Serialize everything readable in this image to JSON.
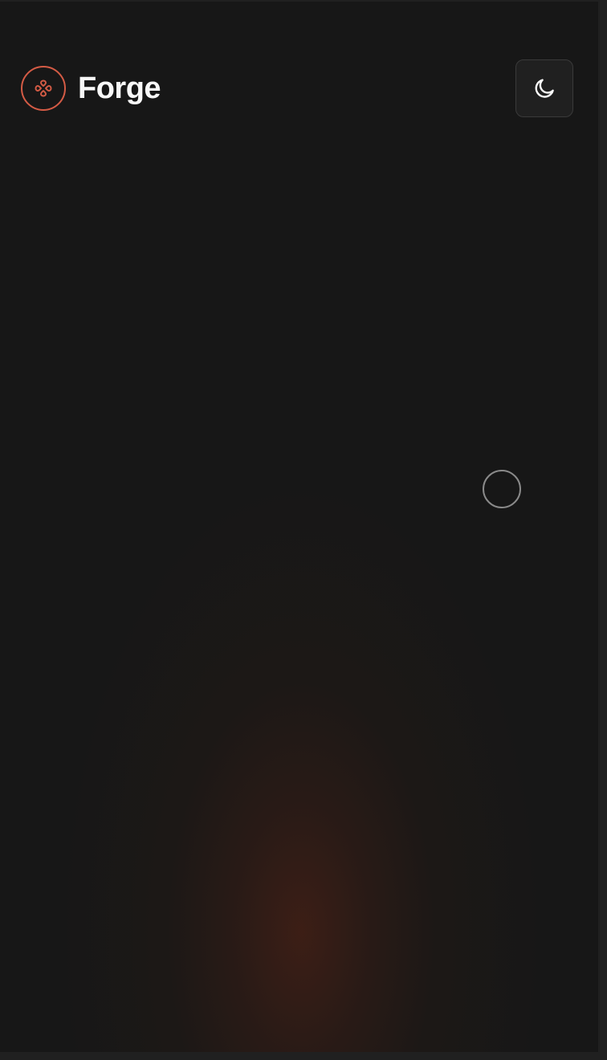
{
  "app": {
    "brand_name": "Forge",
    "logo_icon": "gamepad-icon",
    "theme_toggle_icon": "moon-icon",
    "loading_indicator": "spinner"
  },
  "colors": {
    "accent": "#d45b45",
    "background": "#171717",
    "toggle_background": "#202020"
  }
}
